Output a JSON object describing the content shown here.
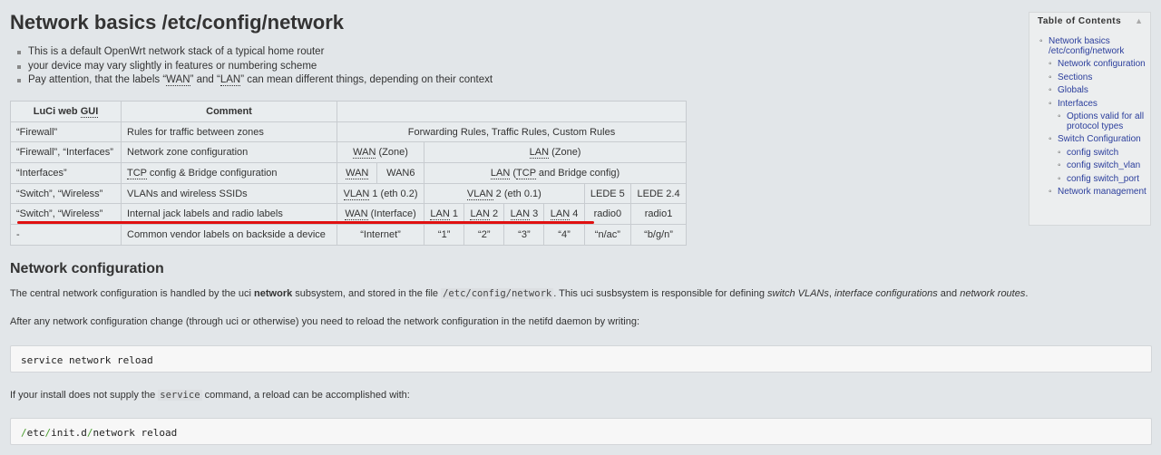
{
  "page": {
    "title": "Network basics /etc/config/network",
    "intro": [
      "This is a default OpenWrt network stack of a typical home router",
      "your device may vary slightly in features or numbering scheme"
    ],
    "intro3": {
      "pre": "Pay attention, that the labels “",
      "wan": "WAN",
      "mid": "” and “",
      "lan": "LAN",
      "post": "” can mean different things, depending on their context"
    }
  },
  "table": {
    "header": {
      "col1_pre": "LuCi web ",
      "col1_abbr": "GUI",
      "col2": "Comment",
      "col3": ""
    },
    "row1": {
      "a": "“Firewall”",
      "b": "Rules for traffic between zones",
      "c": "Forwarding Rules, Traffic Rules, Custom Rules"
    },
    "row2": {
      "a": "“Firewall”, “Interfaces”",
      "b": "Network zone configuration",
      "wan": "WAN",
      "wan_post": " (Zone)",
      "lan": "LAN",
      "lan_post": " (Zone)"
    },
    "row3": {
      "a": "“Interfaces”",
      "b_abbr": "TCP",
      "b_post": " config & Bridge configuration",
      "wan": "WAN",
      "wan6": "WAN6",
      "lan": "LAN",
      "lan_mid": " (",
      "tcp": "TCP",
      "lan_post": " and Bridge config)"
    },
    "row4": {
      "a": "“Switch”, “Wireless”",
      "b": "VLANs and wireless SSIDs",
      "vlan1": "VLAN",
      "vlan1_post": " 1 (eth 0.2)",
      "vlan2": "VLAN",
      "vlan2_post": " 2 (eth 0.1)",
      "lede5": "LEDE 5",
      "lede24": "LEDE 2.4"
    },
    "row5": {
      "a": "“Switch”, “Wireless”",
      "b": "Internal jack labels and radio labels",
      "wan": "WAN",
      "wan_post": " (Interface)",
      "lan": "LAN",
      "lan1": " 1",
      "lan2": " 2",
      "lan3": " 3",
      "lan4": " 4",
      "radio0": "radio0",
      "radio1": "radio1"
    },
    "row6": {
      "a": "-",
      "b": "Common vendor labels on backside a device",
      "internet": "“Internet”",
      "l1": "“1”",
      "l2": "“2”",
      "l3": "“3”",
      "l4": "“4”",
      "nac": "“n/ac”",
      "bgn": "“b/g/n”"
    }
  },
  "section": {
    "heading": "Network configuration",
    "p1": {
      "a": "The central network configuration is handled by the uci ",
      "b": "network",
      "c": " subsystem, and stored in the file ",
      "code": "/etc/config/network",
      "d": ". This uci susbsystem is responsible for defining ",
      "e": "switch VLANs",
      "f": ", ",
      "g": "interface configurations",
      "h": " and ",
      "i": "network routes",
      "j": "."
    },
    "p2": "After any network configuration change (through uci or otherwise) you need to reload the network configuration in the netifd daemon by writing:",
    "code1": "service network reload",
    "p3": {
      "a": "If your install does not supply the ",
      "code": "service",
      "b": " command, a reload can be accomplished with:"
    },
    "code2": {
      "s1": "/",
      "p1": "etc",
      "s2": "/",
      "p2": "init.d",
      "s3": "/",
      "p3": "network reload"
    }
  },
  "toc": {
    "title": "Table of Contents",
    "toggle": "▲",
    "items": {
      "i1": "Network basics /etc/config/network",
      "i2": "Network configuration",
      "i3": "Sections",
      "i4": "Globals",
      "i5": "Interfaces",
      "i6": "Options valid for all protocol types",
      "i7": "Switch Configuration",
      "i8": "config switch",
      "i9": "config switch_vlan",
      "i10": "config switch_port",
      "i11": "Network management"
    }
  },
  "colors": {
    "link": "#2b3e9c",
    "highlight_line": "#e01010",
    "background": "#e2e6e9"
  }
}
